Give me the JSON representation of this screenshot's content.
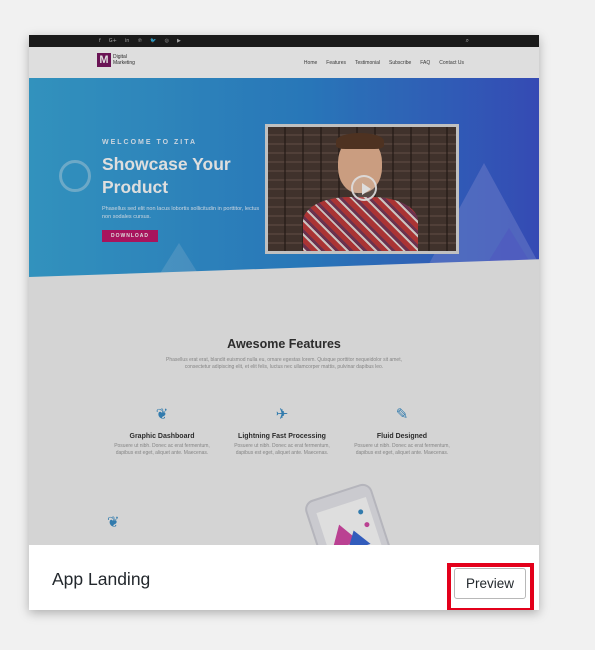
{
  "preview": {
    "social_icons": [
      "f",
      "G+",
      "in",
      "℗",
      "🐦",
      "◎",
      "▶"
    ],
    "logo": {
      "mark": "M",
      "line1": "Digital",
      "line2": "Marketing"
    },
    "menu": [
      "Home",
      "Features",
      "Testimonial",
      "Subscribe",
      "FAQ",
      "Contact Us"
    ],
    "hero": {
      "eyebrow": "WELCOME TO ZITA",
      "headline": "Showcase Your Product",
      "blurb": "Phasellus sed elit non lacus lobortis sollicitudin in porttitor, lectus non sodales cursus.",
      "button": "DOWNLOAD"
    },
    "features": {
      "title": "Awesome Features",
      "subtitle": "Phasellus erat erat, blandit euismod nulla eu, ornare egestas lorem. Quisque porttitor nequeidolor sit amet, consectetur adipiscing elit, et elit felis, luctus nec ullamcorper mattis, pulvinar dapibus leo.",
      "items": [
        {
          "icon": "leaf-icon",
          "title": "Graphic Dashboard",
          "text": "Posuere ut nibh. Donec ac erat fermentum, dapibus est eget, aliquet ante. Maecenas."
        },
        {
          "icon": "plane-icon",
          "title": "Lightning Fast Processing",
          "text": "Posuere ut nibh. Donec ac erat fermentum, dapibus est eget, aliquet ante. Maecenas."
        },
        {
          "icon": "pencil-square-icon",
          "title": "Fluid Designed",
          "text": "Posuere ut nibh. Donec ac erat fermentum, dapibus est eget, aliquet ante. Maecenas."
        }
      ]
    }
  },
  "card": {
    "title": "App Landing",
    "preview_button": "Preview"
  },
  "colors": {
    "highlight": "#e3001b",
    "hero_start": "#3aa8d9",
    "hero_end": "#3d56cf",
    "accent_button": "#c2186b"
  }
}
